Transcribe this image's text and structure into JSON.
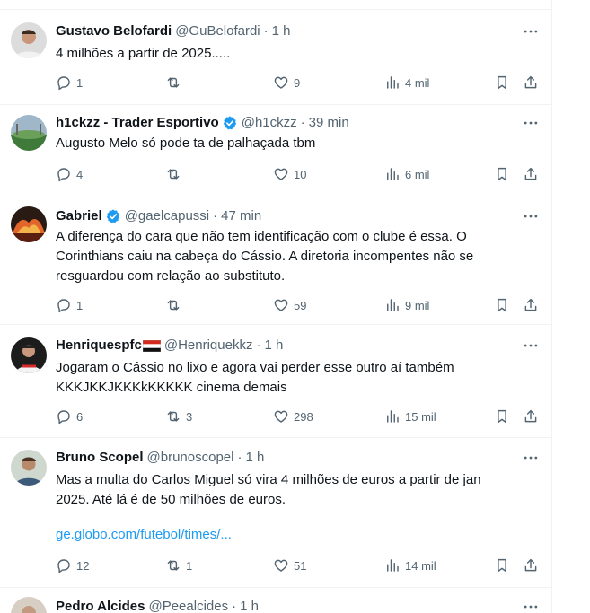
{
  "tweets": [
    {
      "name": "Gustavo Belofardi",
      "handle": "@GuBelofardi",
      "sep": "·",
      "time": "1 h",
      "text": "4 milhões a partir de 2025.....",
      "replies": "1",
      "retweets": "",
      "likes": "9",
      "views": "4 mil"
    },
    {
      "name": "h1ckzz - Trader Esportivo",
      "handle": "@h1ckzz",
      "sep": "·",
      "time": "39 min",
      "text": "Augusto Melo só pode ta de palhaçada tbm",
      "replies": "4",
      "retweets": "",
      "likes": "10",
      "views": "6 mil",
      "verified": true
    },
    {
      "name": "Gabriel",
      "handle": "@gaelcapussi",
      "sep": "·",
      "time": "47 min",
      "text": "A diferença do cara que não tem identificação com o clube é essa. O\nCorinthians caiu na cabeça do Cássio. A diretoria incompentes não se\nresguardou com relação ao substituto.",
      "replies": "1",
      "retweets": "",
      "likes": "59",
      "views": "9 mil",
      "verified": true
    },
    {
      "name": "Henriquespfc",
      "handle": "@Henriquekkz",
      "sep": "·",
      "time": "1 h",
      "text": "Jogaram o Cássio no lixo e agora vai perder esse outro aí também\nKKKJKKJKKKkKKKKK cinema demais",
      "replies": "6",
      "retweets": "3",
      "likes": "298",
      "views": "15 mil"
    },
    {
      "name": "Bruno Scopel",
      "handle": "@brunoscopel",
      "sep": "·",
      "time": "1 h",
      "text": "Mas a multa do Carlos Miguel só vira 4 milhões de euros a partir de jan\n2025. Até lá é de 50 milhões de euros.",
      "link": "ge.globo.com/futebol/times/...",
      "replies": "12",
      "retweets": "1",
      "likes": "51",
      "views": "14 mil"
    },
    {
      "name": "Pedro Alcides",
      "handle": "@Peealcides",
      "sep": "·",
      "time": "1 h"
    }
  ],
  "icons": {
    "reply": "reply-icon",
    "retweet": "retweet-icon",
    "like": "heart-icon",
    "views": "views-icon",
    "bookmark": "bookmark-icon",
    "share": "share-icon",
    "more": "more-icon",
    "verified": "verified-badge-icon"
  },
  "colors": {
    "text": "#0f1419",
    "muted": "#536471",
    "link": "#1d9bf0",
    "verified": "#1d9bf0",
    "border": "#eff3f4"
  }
}
